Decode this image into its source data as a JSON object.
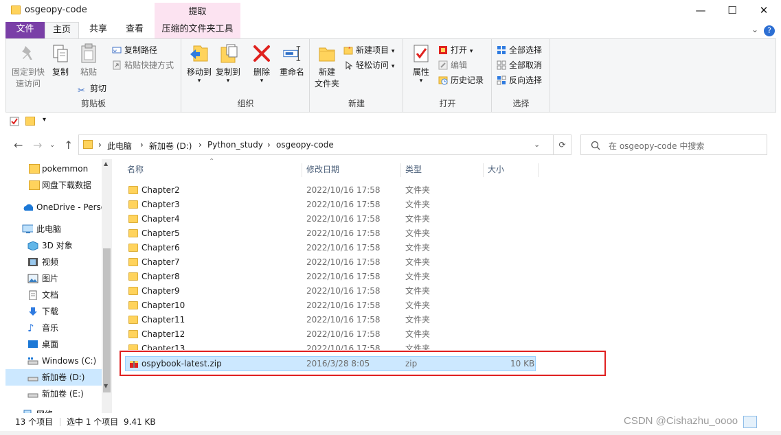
{
  "window": {
    "title": "osgeopy-code",
    "contextual_tab_group": "提取",
    "minimize": "—",
    "maximize": "☐",
    "close": "✕"
  },
  "tabs": {
    "file": "文件",
    "home": "主页",
    "share": "共享",
    "view": "查看",
    "zip_tools": "压缩的文件夹工具",
    "help": "?"
  },
  "ribbon": {
    "clipboard": {
      "pin": "固定到快\n速访问",
      "copy": "复制",
      "paste": "粘贴",
      "copy_path": "复制路径",
      "paste_shortcut": "粘贴快捷方式",
      "cut": "剪切",
      "label": "剪贴板"
    },
    "organize": {
      "move_to": "移动到",
      "copy_to": "复制到",
      "delete": "删除",
      "rename": "重命名",
      "label": "组织"
    },
    "new": {
      "new_folder": "新建\n文件夹",
      "new_item": "新建项目",
      "easy_access": "轻松访问",
      "label": "新建"
    },
    "open": {
      "properties": "属性",
      "open": "打开",
      "edit": "编辑",
      "history": "历史记录",
      "label": "打开"
    },
    "select": {
      "select_all": "全部选择",
      "select_none": "全部取消",
      "invert": "反向选择",
      "label": "选择"
    }
  },
  "address": {
    "crumbs": [
      "此电脑",
      "新加卷 (D:)",
      "Python_study",
      "osgeopy-code"
    ],
    "search_placeholder": "在 osgeopy-code 中搜索"
  },
  "nav": {
    "items": [
      {
        "label": "pokemmon",
        "icon": "folder-icon"
      },
      {
        "label": "网盘下载数据",
        "icon": "folder-icon"
      },
      {
        "label": "OneDrive - Perso",
        "icon": "cloud-icon"
      },
      {
        "label": "此电脑",
        "icon": "computer-icon"
      },
      {
        "label": "3D 对象",
        "icon": "cube-icon"
      },
      {
        "label": "视频",
        "icon": "video-icon"
      },
      {
        "label": "图片",
        "icon": "picture-icon"
      },
      {
        "label": "文档",
        "icon": "document-icon"
      },
      {
        "label": "下载",
        "icon": "download-icon"
      },
      {
        "label": "音乐",
        "icon": "music-icon"
      },
      {
        "label": "桌面",
        "icon": "desktop-icon"
      },
      {
        "label": "Windows (C:)",
        "icon": "drive-icon"
      },
      {
        "label": "新加卷 (D:)",
        "icon": "drive-icon"
      },
      {
        "label": "新加卷 (E:)",
        "icon": "drive-icon"
      },
      {
        "label": "网络",
        "icon": "network-icon"
      }
    ]
  },
  "columns": {
    "name": "名称",
    "modified": "修改日期",
    "type": "类型",
    "size": "大小"
  },
  "files": [
    {
      "name": "Chapter2",
      "date": "2022/10/16 17:58",
      "type": "文件夹",
      "size": ""
    },
    {
      "name": "Chapter3",
      "date": "2022/10/16 17:58",
      "type": "文件夹",
      "size": ""
    },
    {
      "name": "Chapter4",
      "date": "2022/10/16 17:58",
      "type": "文件夹",
      "size": ""
    },
    {
      "name": "Chapter5",
      "date": "2022/10/16 17:58",
      "type": "文件夹",
      "size": ""
    },
    {
      "name": "Chapter6",
      "date": "2022/10/16 17:58",
      "type": "文件夹",
      "size": ""
    },
    {
      "name": "Chapter7",
      "date": "2022/10/16 17:58",
      "type": "文件夹",
      "size": ""
    },
    {
      "name": "Chapter8",
      "date": "2022/10/16 17:58",
      "type": "文件夹",
      "size": ""
    },
    {
      "name": "Chapter9",
      "date": "2022/10/16 17:58",
      "type": "文件夹",
      "size": ""
    },
    {
      "name": "Chapter10",
      "date": "2022/10/16 17:58",
      "type": "文件夹",
      "size": ""
    },
    {
      "name": "Chapter11",
      "date": "2022/10/16 17:58",
      "type": "文件夹",
      "size": ""
    },
    {
      "name": "Chapter12",
      "date": "2022/10/16 17:58",
      "type": "文件夹",
      "size": ""
    },
    {
      "name": "Chapter13",
      "date": "2022/10/16 17:58",
      "type": "文件夹",
      "size": ""
    },
    {
      "name": "ospybook-latest.zip",
      "date": "2016/3/28 8:05",
      "type": "zip",
      "size": "10 KB"
    }
  ],
  "status": {
    "item_count": "13 个项目",
    "selection": "选中 1 个项目",
    "selection_size": "9.41 KB"
  },
  "watermark": "CSDN @Cishazhu_oooo",
  "colors": {
    "file_tab": "#7a3fa7",
    "context_tab": "#fce3f1",
    "selection": "#cce8ff",
    "highlight_box": "#e02020"
  }
}
